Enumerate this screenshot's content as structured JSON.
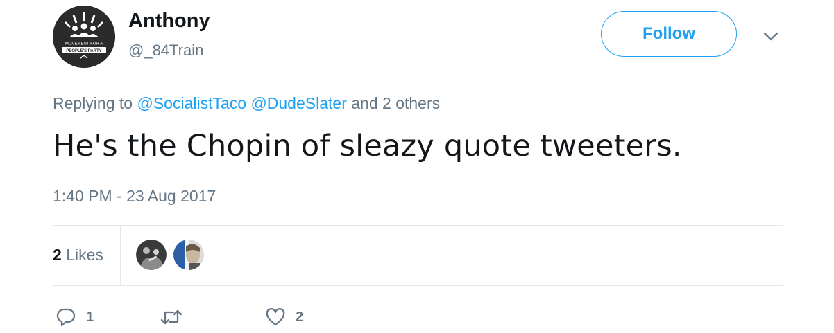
{
  "user": {
    "name": "Anthony",
    "handle": "@_84Train",
    "avatar_text_line1": "MOVEMENT FOR A",
    "avatar_text_line2": "PEOPLE'S PARTY"
  },
  "follow_label": "Follow",
  "reply_context": {
    "prefix": "Replying to",
    "mention1": "@SocialistTaco",
    "mention2": "@DudeSlater",
    "suffix": "and 2 others"
  },
  "tweet_text": "He's the Chopin of sleazy quote tweeters.",
  "timestamp": "1:40 PM - 23 Aug 2017",
  "likes": {
    "count": "2",
    "label": "Likes"
  },
  "actions": {
    "reply_count": "1",
    "retweet_count": "",
    "like_count": "2"
  },
  "colors": {
    "accent": "#1da1f2",
    "secondary_text": "#657786",
    "divider": "#e1e8ed"
  },
  "icons": [
    "chevron-down-icon",
    "reply-icon",
    "retweet-icon",
    "heart-icon"
  ]
}
